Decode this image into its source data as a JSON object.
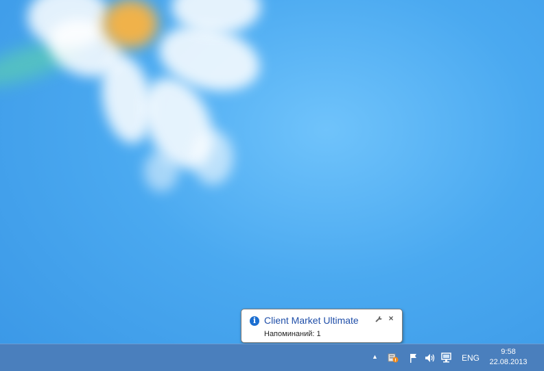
{
  "notification": {
    "title": "Client Market Ultimate",
    "message": "Напоминаний: 1",
    "info_icon": "i",
    "close_glyph": "×"
  },
  "taskbar": {
    "chevron": "▲",
    "language": "ENG",
    "time": "9:58",
    "date": "22.08.2013"
  },
  "icons": {
    "notification_info": "info-icon",
    "notification_options": "wrench-icon",
    "notification_close": "close-icon",
    "tray_app": "client-market-icon",
    "tray_flag": "action-center-flag-icon",
    "tray_volume": "speaker-icon",
    "tray_network": "network-icon",
    "tray_overflow": "chevron-up-icon"
  },
  "colors": {
    "desktop_blue": "#4aa9f0",
    "taskbar": "#4a7fbd",
    "balloon_title": "#1f4ea8",
    "info_icon": "#1c6fd1"
  }
}
